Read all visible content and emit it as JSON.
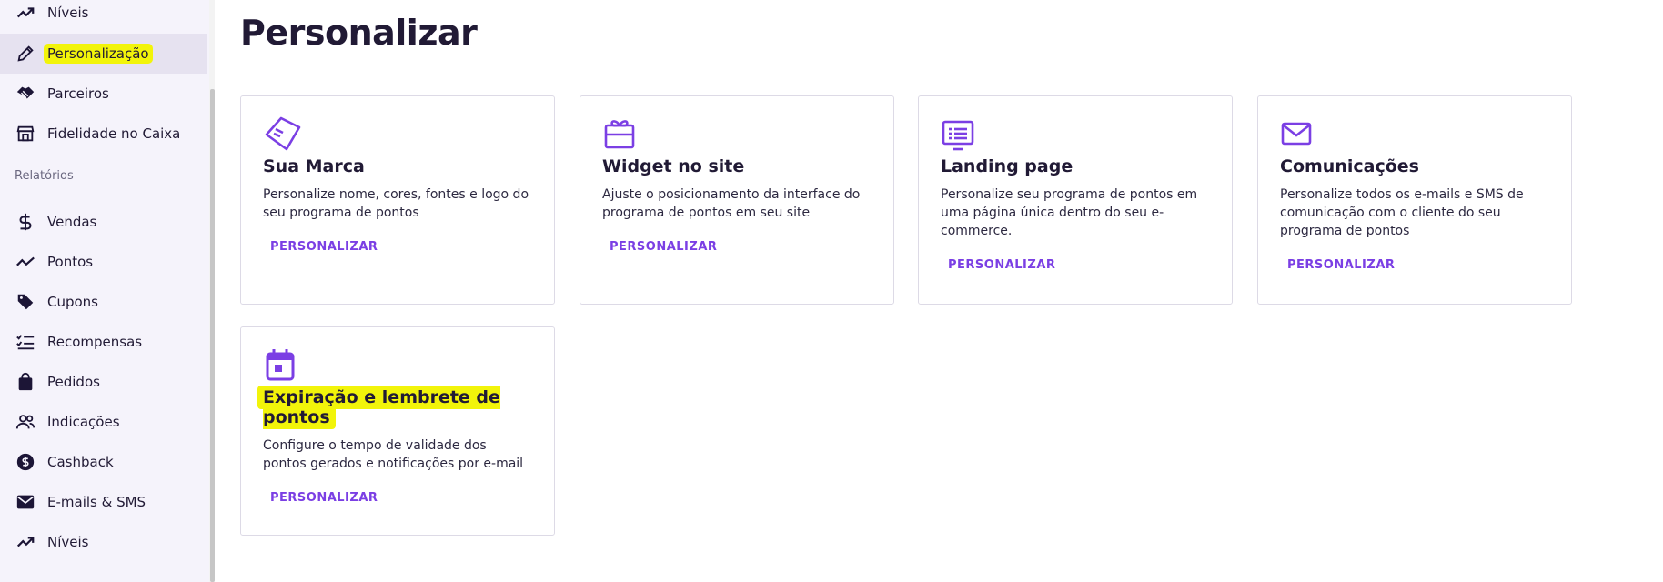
{
  "sidebar": {
    "items_top": [
      {
        "label": "Níveis",
        "icon": "trending-up-icon"
      },
      {
        "label": "Personalização",
        "icon": "pencil-icon",
        "active": true,
        "highlighted": true
      },
      {
        "label": "Parceiros",
        "icon": "handshake-icon"
      },
      {
        "label": "Fidelidade no Caixa",
        "icon": "store-icon"
      }
    ],
    "section_reports": "Relatórios",
    "items_reports": [
      {
        "label": "Vendas",
        "icon": "dollar-icon"
      },
      {
        "label": "Pontos",
        "icon": "trending-up-icon"
      },
      {
        "label": "Cupons",
        "icon": "tag-icon"
      },
      {
        "label": "Recompensas",
        "icon": "checklist-icon"
      },
      {
        "label": "Pedidos",
        "icon": "shopping-bag-icon"
      },
      {
        "label": "Indicações",
        "icon": "people-icon"
      },
      {
        "label": "Cashback",
        "icon": "coin-icon"
      },
      {
        "label": "E-mails & SMS",
        "icon": "mail-icon"
      },
      {
        "label": "Níveis",
        "icon": "trending-up-icon"
      }
    ]
  },
  "main": {
    "title": "Personalizar",
    "cards": [
      {
        "title": "Sua Marca",
        "description": "Personalize nome, cores, fontes e logo do seu programa de pontos",
        "button": "PERSONALIZAR",
        "icon": "brand-tag-icon"
      },
      {
        "title": "Widget no site",
        "description": "Ajuste o posicionamento da interface do programa de pontos em seu site",
        "button": "PERSONALIZAR",
        "icon": "gift-card-icon"
      },
      {
        "title": "Landing page",
        "description": "Personalize seu programa de pontos em uma página única dentro do seu e-commerce.",
        "button": "PERSONALIZAR",
        "icon": "monitor-icon"
      },
      {
        "title": "Comunicações",
        "description": "Personalize todos os e-mails e SMS de comunicação com o cliente do seu programa de pontos",
        "button": "PERSONALIZAR",
        "icon": "envelope-icon"
      },
      {
        "title": "Expiração e lembrete de pontos",
        "description": "Configure o tempo de validade dos pontos gerados e notificações por e-mail",
        "button": "PERSONALIZAR",
        "icon": "calendar-icon",
        "highlighted": true
      }
    ]
  },
  "colors": {
    "accent": "#7b3fe4",
    "highlight": "#f2f40a",
    "sidebar_bg": "#f5f3fb",
    "text": "#211a35"
  }
}
